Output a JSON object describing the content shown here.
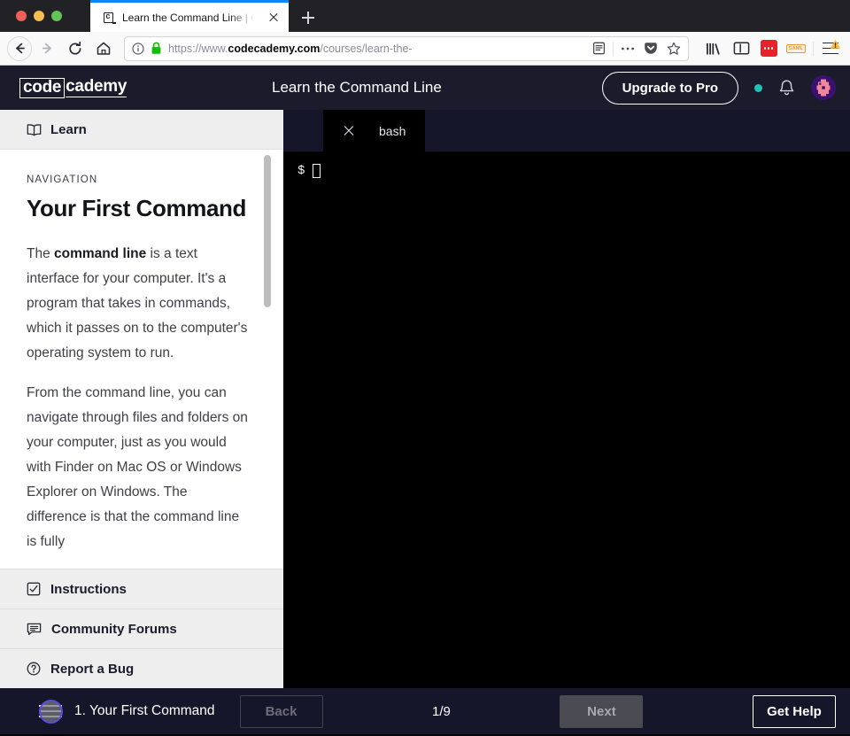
{
  "browser": {
    "traffic_lights": [
      "close",
      "minimize",
      "maximize"
    ],
    "tab": {
      "favicon_letter": "c",
      "title": "Learn the Command Line | Cod",
      "close_icon": "close-icon"
    },
    "new_tab_label": "+",
    "nav": {
      "back_icon": "back-arrow-icon",
      "forward_icon": "forward-arrow-icon",
      "reload_icon": "reload-icon",
      "home_icon": "home-icon"
    },
    "url": {
      "scheme_prefix": "https://www.",
      "domain": "codecademy.com",
      "path": "/courses/learn-the-",
      "info_icon": "page-info-icon",
      "lock_icon": "lock-icon",
      "reader_icon": "reader-view-icon",
      "more_icon": "page-actions-icon",
      "pocket_icon": "pocket-icon",
      "bookmark_icon": "star-bookmark-icon"
    },
    "toolbar": {
      "library_icon": "library-icon",
      "sidebar_icon": "sidebar-icon",
      "extension_red": "extension-icon",
      "extension_saml_label": "SAML",
      "menu_icon": "app-menu-icon",
      "warning_icon": "warning-triangle-icon"
    }
  },
  "header": {
    "logo_boxed": "code",
    "logo_rest": "cademy",
    "title": "Learn the Command Line",
    "upgrade_label": "Upgrade to Pro",
    "status_dot": "online-status-dot",
    "bell_icon": "notifications-bell-icon",
    "avatar": "user-avatar"
  },
  "sidebar": {
    "learn_label": "Learn",
    "learn_icon": "book-icon",
    "nav_label": "NAVIGATION",
    "lesson_title": "Your First Command",
    "paragraph1_pre": "The ",
    "paragraph1_bold": "command line",
    "paragraph1_post": " is a text interface for your computer. It's a program that takes in commands, which it passes on to the computer's operating system to run.",
    "paragraph2": "From the command line, you can navigate through files and folders on your computer, just as you would with Finder on Mac OS or Windows Explorer on Windows. The difference is that the command line is fully",
    "links": [
      {
        "label": "Instructions",
        "icon": "checkbox-icon"
      },
      {
        "label": "Community Forums",
        "icon": "speech-bubble-icon"
      },
      {
        "label": "Report a Bug",
        "icon": "question-circle-icon"
      }
    ]
  },
  "terminal": {
    "tab_label": "bash",
    "tab_close_icon": "close-icon",
    "prompt": "$",
    "cursor": "block-cursor"
  },
  "bottombar": {
    "menu_icon": "lesson-menu-icon",
    "lesson_name": "1. Your First Command",
    "back_label": "Back",
    "page_count": "1/9",
    "next_label": "Next",
    "help_label": "Get Help"
  },
  "colors": {
    "header_bg": "#1b1b2c",
    "bottom_bg": "#16162a",
    "terminal_bg": "#000000",
    "accent_teal": "#21c3b6",
    "cursor_ring": "#5b4ce0",
    "tab_accent": "#0a84ff"
  }
}
